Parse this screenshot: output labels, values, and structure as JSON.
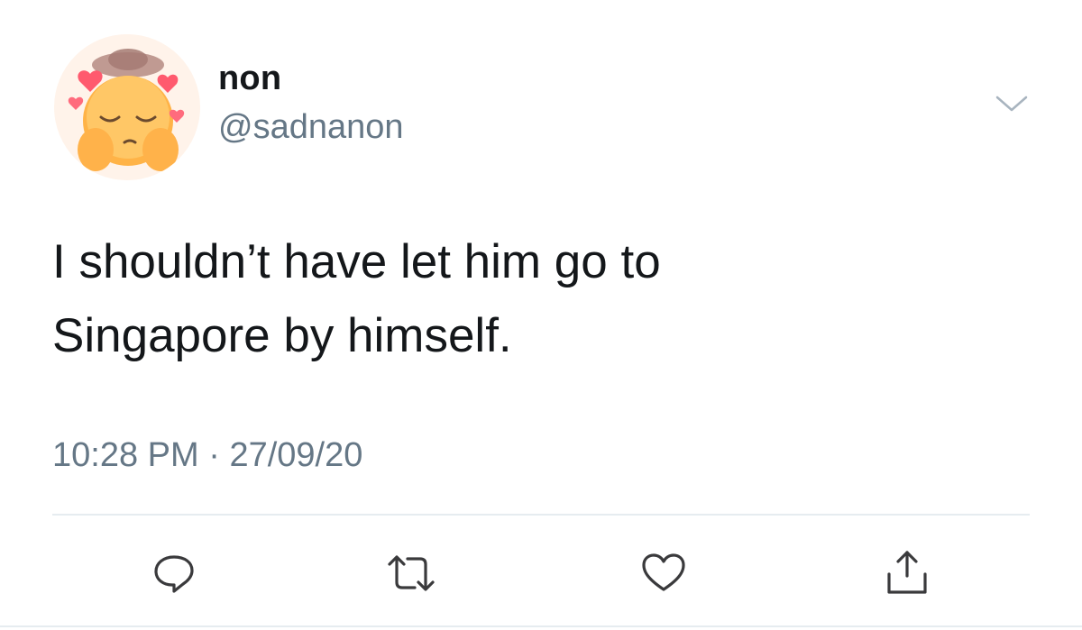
{
  "user": {
    "display_name": "non",
    "handle": "@sadnanon"
  },
  "tweet": {
    "lines": [
      "I shouldn’t have let him go to",
      "Singapore by himself."
    ],
    "time": "10:28 PM",
    "separator": " · ",
    "date": "27/09/20"
  },
  "actions": [
    {
      "icon": "reply-icon"
    },
    {
      "icon": "retweet-icon"
    },
    {
      "icon": "like-icon"
    },
    {
      "icon": "share-icon"
    }
  ],
  "colors": {
    "text": "#14171a",
    "secondary": "#657786",
    "divider": "#e6ecf0",
    "icon": "#3a3a3c"
  }
}
